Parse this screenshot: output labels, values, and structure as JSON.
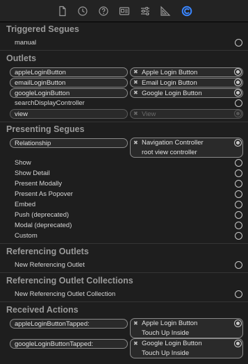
{
  "toolbar": {
    "icons": [
      "file-icon",
      "clock-icon",
      "help-icon",
      "identity-card-icon",
      "sliders-icon",
      "ruler-icon",
      "connections-icon"
    ],
    "accent": "#3a86ff"
  },
  "sections": {
    "triggered_segues": "Triggered Segues",
    "outlets": "Outlets",
    "presenting_segues": "Presenting Segues",
    "referencing_outlets": "Referencing Outlets",
    "referencing_outlet_collections": "Referencing Outlet Collections",
    "received_actions": "Received Actions"
  },
  "triggered": {
    "manual": "manual"
  },
  "outlets": {
    "apple_login_button": {
      "name": "appleLoginButton",
      "target": "Apple Login Button"
    },
    "email_login_button": {
      "name": "emailLoginButton",
      "target": "Email Login Button"
    },
    "google_login_button": {
      "name": "googleLoginButton",
      "target": "Google Login Button"
    },
    "search_display_controller": {
      "name": "searchDisplayController"
    },
    "view": {
      "name": "view",
      "target": "View"
    }
  },
  "presenting": {
    "relationship": {
      "name": "Relationship",
      "target_line1": "Navigation Controller",
      "target_line2": "root view controller"
    },
    "show": "Show",
    "show_detail": "Show Detail",
    "present_modally": "Present Modally",
    "present_as_popover": "Present As Popover",
    "embed": "Embed",
    "push": "Push (deprecated)",
    "modal": "Modal (deprecated)",
    "custom": "Custom"
  },
  "referencing": {
    "new_outlet": "New Referencing Outlet"
  },
  "referencing_collections": {
    "new_collection": "New Referencing Outlet Collection"
  },
  "actions": {
    "apple_tapped": {
      "name": "appleLoginButtonTapped:",
      "target_line1": "Apple Login Button",
      "target_line2": "Touch Up Inside"
    },
    "google_tapped": {
      "name": "googleLoginButtonTapped:",
      "target_line1": "Google Login Button",
      "target_line2": "Touch Up Inside"
    }
  }
}
